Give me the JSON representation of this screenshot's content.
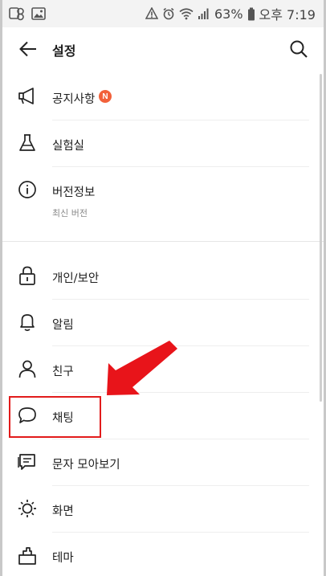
{
  "status_bar": {
    "battery": "63%",
    "time": "오후 7:19"
  },
  "header": {
    "title": "설정"
  },
  "settings": {
    "notice": {
      "label": "공지사항",
      "badge": "N"
    },
    "lab": {
      "label": "실험실"
    },
    "version": {
      "label": "버전정보",
      "sub": "최신 버전"
    },
    "privacy": {
      "label": "개인/보안"
    },
    "alarm": {
      "label": "알림"
    },
    "friends": {
      "label": "친구"
    },
    "chat": {
      "label": "채팅"
    },
    "sms": {
      "label": "문자 모아보기"
    },
    "screen": {
      "label": "화면"
    },
    "theme": {
      "label": "테마"
    }
  },
  "annotation": {
    "arrow_color": "#e8141a",
    "highlight_color": "#e21b1b"
  },
  "colors": {
    "badge": "#f2613a",
    "text": "#1e1e1e",
    "subtext": "#8a8a8a"
  }
}
